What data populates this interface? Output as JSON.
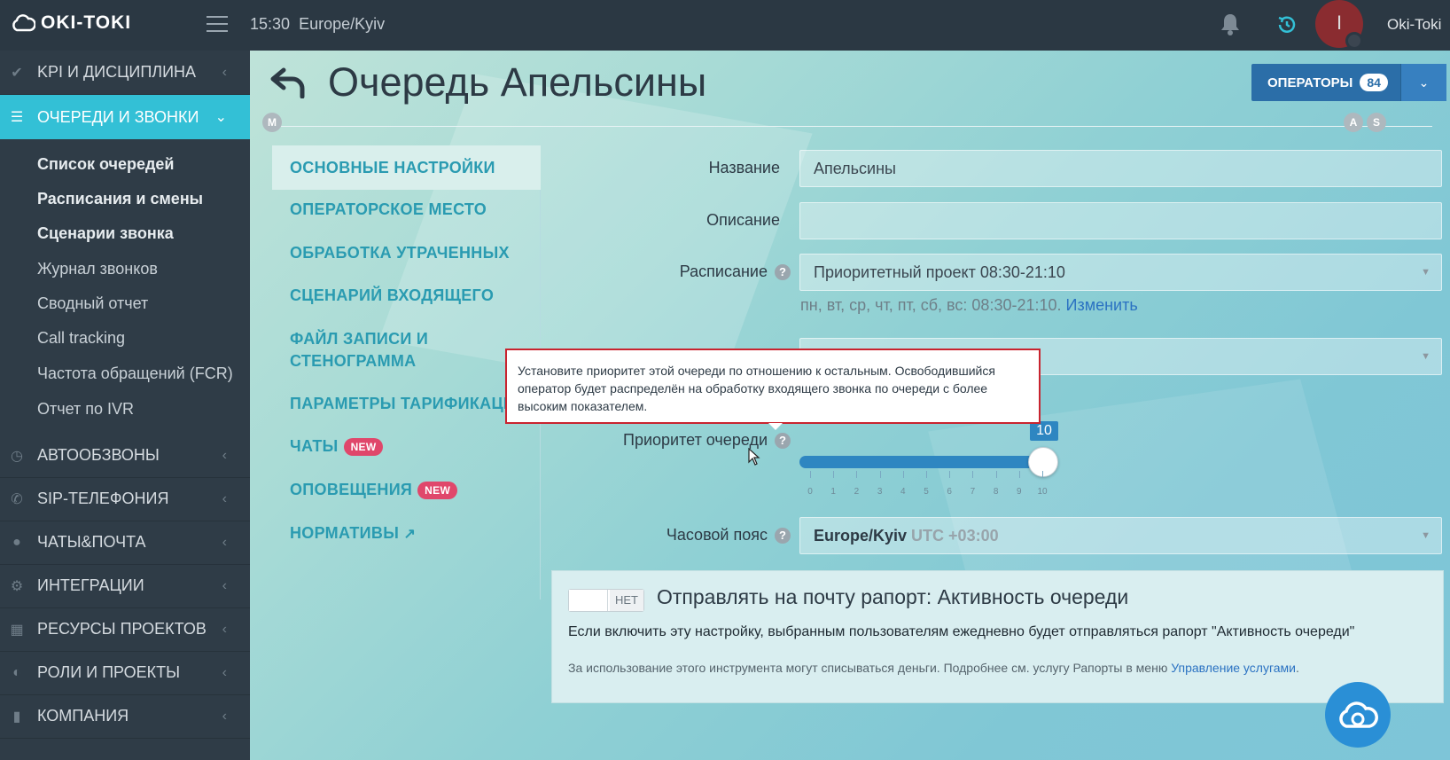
{
  "topbar": {
    "logo_text": "OKI-TOKI",
    "time": "15:30",
    "timezone": "Europe/Kyiv",
    "avatar_initial": "I",
    "username": "Oki-Toki"
  },
  "sidebar": {
    "items": [
      {
        "label": "KPI И ДИСЦИПЛИНА",
        "icon": "check-icon"
      },
      {
        "label": "ОЧЕРЕДИ И ЗВОНКИ",
        "icon": "list-icon"
      },
      {
        "label": "АВТООБЗВОНЫ",
        "icon": "clock-icon"
      },
      {
        "label": "SIP-ТЕЛЕФОНИЯ",
        "icon": "phone-icon"
      },
      {
        "label": "ЧАТЫ&ПОЧТА",
        "icon": "chat-icon"
      },
      {
        "label": "ИНТЕГРАЦИИ",
        "icon": "gears-icon"
      },
      {
        "label": "РЕСУРСЫ ПРОЕКТОВ",
        "icon": "grid-icon"
      },
      {
        "label": "РОЛИ И ПРОЕКТЫ",
        "icon": "toggle-icon"
      },
      {
        "label": "КОМПАНИЯ",
        "icon": "bar-chart-icon"
      }
    ],
    "subitems": [
      "Список очередей",
      "Расписания и смены",
      "Сценарии звонка",
      "Журнал звонков",
      "Сводный отчет",
      "Call tracking",
      "Частота обращений (FCR)",
      "Отчет по IVR"
    ]
  },
  "header": {
    "title": "Очередь Апельсины",
    "operators_label": "ОПЕРАТОРЫ",
    "operators_count": "84",
    "tag_m": "M",
    "tag_a": "A",
    "tag_s": "S"
  },
  "settings_menu": {
    "items": [
      "ОСНОВНЫЕ НАСТРОЙКИ",
      "ОПЕРАТОРСКОЕ МЕСТО",
      "ОБРАБОТКА УТРАЧЕННЫХ",
      "СЦЕНАРИЙ ВХОДЯЩЕГО",
      "ФАЙЛ ЗАПИСИ И СТЕНОГРАММА",
      "ПАРАМЕТРЫ ТАРИФИКАЦИИ",
      "ЧАТЫ",
      "ОПОВЕЩЕНИЯ",
      "НОРМАТИВЫ"
    ],
    "new_badge": "NEW"
  },
  "form": {
    "name_label": "Название",
    "name_value": "Апельсины",
    "description_label": "Описание",
    "description_value": "",
    "schedule_label": "Расписание",
    "schedule_value": "Приоритетный проект 08:30-21:10",
    "schedule_note": "пн, вт, ср, чт, пт, сб, вс: 08:30-21:10.",
    "schedule_change": "Изменить",
    "priority_label": "Приоритет очереди",
    "priority_value": "10",
    "priority_min": 0,
    "priority_max": 10,
    "tick_labels": [
      "0",
      "1",
      "2",
      "3",
      "4",
      "5",
      "6",
      "7",
      "8",
      "9",
      "10"
    ],
    "timezone_label": "Часовой пояс",
    "timezone_value": "Europe/Kyiv",
    "timezone_offset": "UTC +03:00"
  },
  "tooltip": {
    "text": "Установите приоритет этой очереди по отношению к остальным. Освободившийся оператор будет распределён на обработку входящего звонка по очереди с более высоким показателем."
  },
  "report": {
    "toggle_label": "НЕТ",
    "title": "Отправлять на почту рапорт: Активность очереди",
    "description": "Если включить эту настройку, выбранным пользователям ежедневно будет отправляться рапорт \"Активность очереди\"",
    "note": "За использование этого инструмента могут списываться деньги. Подробнее см. услугу Рапорты в меню",
    "note_link": "Управление услугами",
    "note_end": "."
  }
}
